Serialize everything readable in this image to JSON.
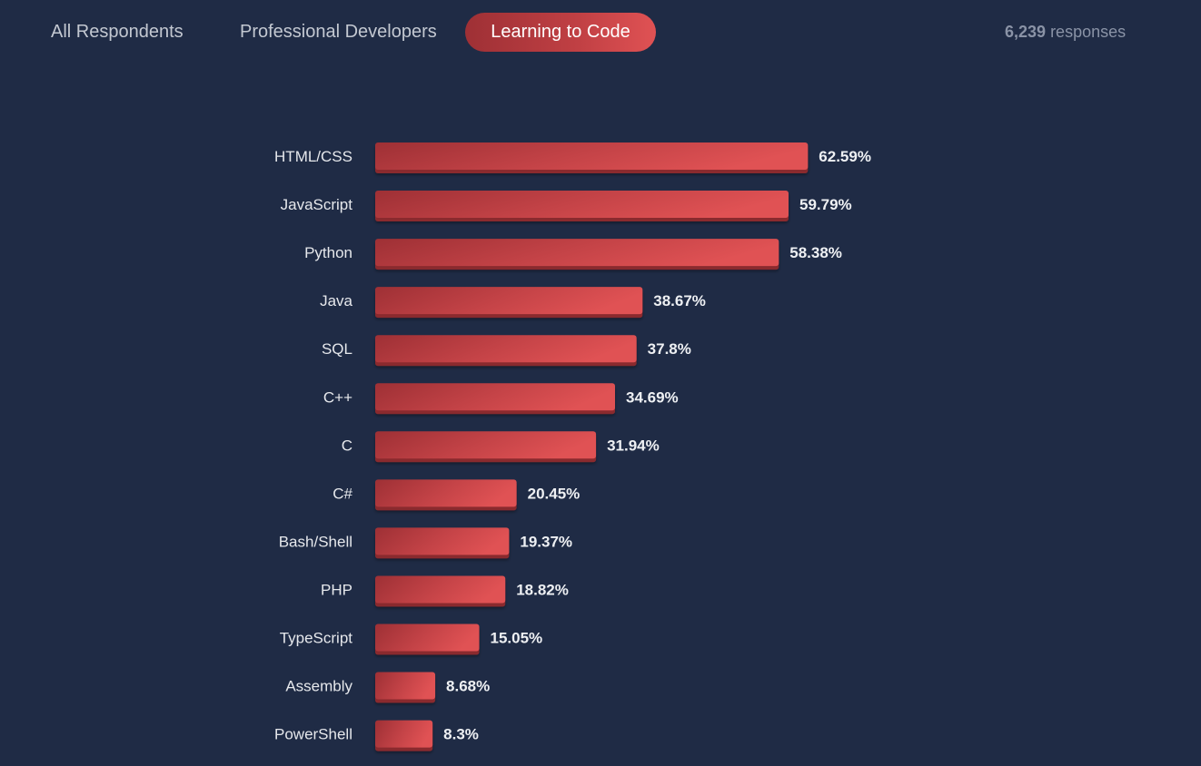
{
  "tabs": [
    {
      "label": "All Respondents",
      "active": false
    },
    {
      "label": "Professional Developers",
      "active": false
    },
    {
      "label": "Learning to Code",
      "active": true
    }
  ],
  "responses": {
    "count": "6,239",
    "label": "responses"
  },
  "colors": {
    "background": "#1f2b45",
    "bar_start": "#9e3035",
    "bar_end": "#e05254",
    "bar_lip": "#8a2a2e",
    "label_text": "#e6e8ec",
    "muted_text": "#8a93a6"
  },
  "chart_data": {
    "type": "bar",
    "orientation": "horizontal",
    "title": "",
    "xlabel": "",
    "ylabel": "",
    "unit": "%",
    "xlim": [
      0,
      100
    ],
    "grid": false,
    "legend": "none",
    "categories": [
      "HTML/CSS",
      "JavaScript",
      "Python",
      "Java",
      "SQL",
      "C++",
      "C",
      "C#",
      "Bash/Shell",
      "PHP",
      "TypeScript",
      "Assembly",
      "PowerShell"
    ],
    "values": [
      62.59,
      59.79,
      58.38,
      38.67,
      37.8,
      34.69,
      31.94,
      20.45,
      19.37,
      18.82,
      15.05,
      8.68,
      8.3
    ],
    "value_labels": [
      "62.59%",
      "59.79%",
      "58.38%",
      "38.67%",
      "37.8%",
      "34.69%",
      "31.94%",
      "20.45%",
      "19.37%",
      "18.82%",
      "15.05%",
      "8.68%",
      "8.3%"
    ]
  }
}
